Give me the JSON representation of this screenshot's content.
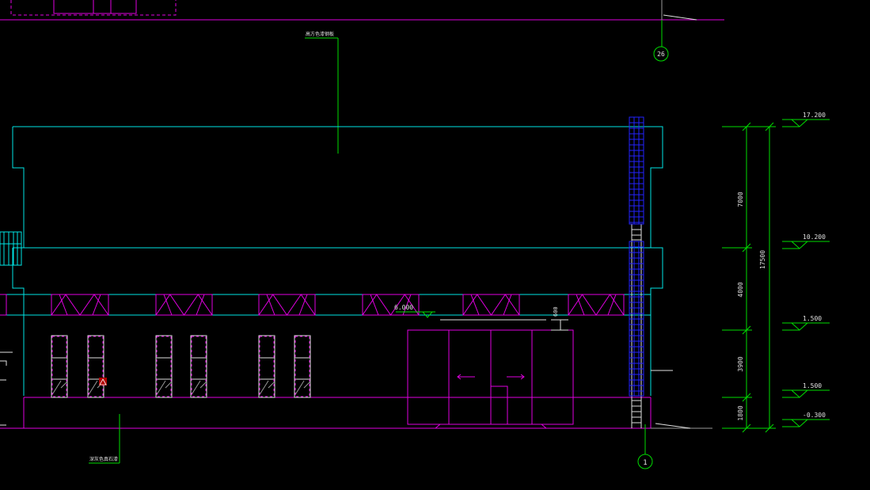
{
  "drawing": {
    "background": "#000000",
    "colors": {
      "cyan": "#00e5e5",
      "magenta": "#e000e0",
      "green": "#00dd00",
      "blue": "#1a1aff",
      "white": "#e0e0e0",
      "dim": "#9a9a9a"
    },
    "annotations": {
      "top_note": "高方色漆钢板",
      "bottom_note": "深灰色真石漆",
      "door_level": "6.000",
      "door_head_dim": "600"
    },
    "grid_bubbles": {
      "top": "26",
      "bottom": "1"
    },
    "elevations": [
      "17.200",
      "10.200",
      "1.500",
      "1.500",
      "-0.300"
    ],
    "dimensions": {
      "segments": [
        "7000",
        "4000",
        "3900",
        "1800"
      ],
      "total": "17500"
    },
    "icons": [
      "warning-sign-icon",
      "arrow-left-icon",
      "arrow-right-icon"
    ]
  }
}
